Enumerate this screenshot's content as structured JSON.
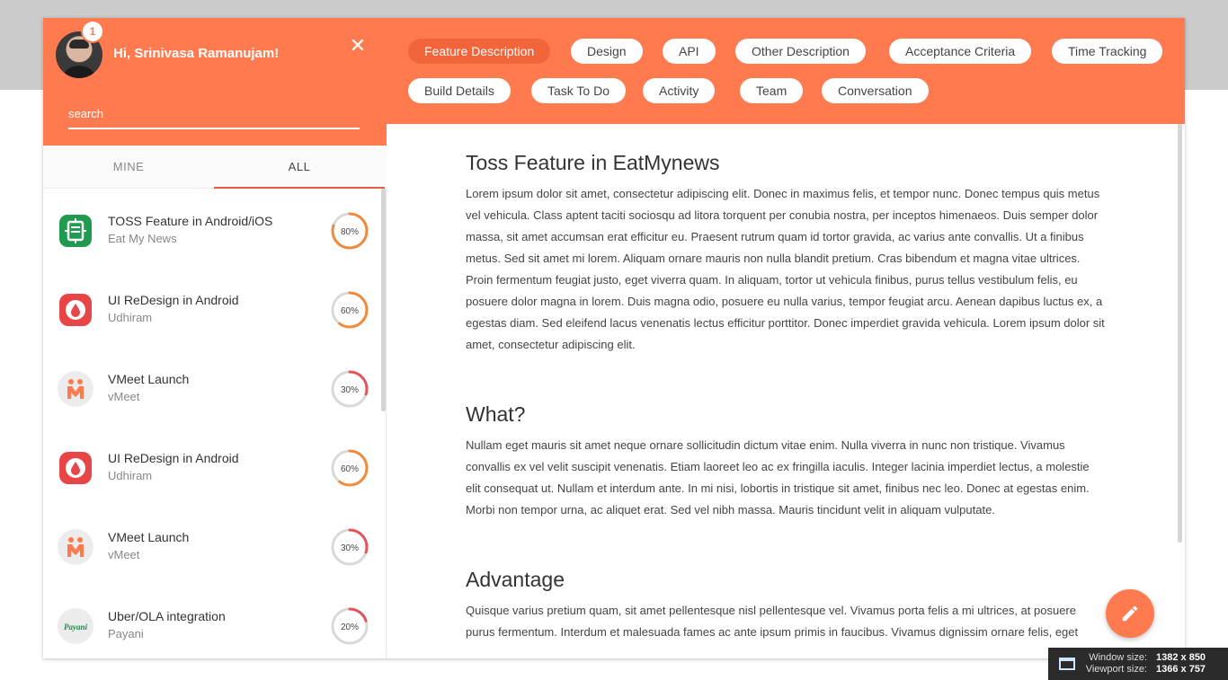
{
  "user": {
    "greeting": "Hi, Srinivasa Ramanujam!",
    "notification_count": "1"
  },
  "search": {
    "placeholder": "search"
  },
  "tabs": [
    {
      "label": "MINE"
    },
    {
      "label": "ALL",
      "active": true
    }
  ],
  "items": [
    {
      "title": "TOSS Feature in Android/iOS",
      "subtitle": "Eat My News",
      "progress": 80,
      "progress_label": "80%",
      "logo": "eatmynews-logo"
    },
    {
      "title": "UI ReDesign in Android",
      "subtitle": "Udhiram",
      "progress": 60,
      "progress_label": "60%",
      "logo": "udhiram-logo"
    },
    {
      "title": "VMeet Launch",
      "subtitle": "vMeet",
      "progress": 30,
      "progress_label": "30%",
      "logo": "vmeet-logo"
    },
    {
      "title": "UI ReDesign in Android",
      "subtitle": "Udhiram",
      "progress": 60,
      "progress_label": "60%",
      "logo": "udhiram-logo"
    },
    {
      "title": "VMeet Launch",
      "subtitle": "vMeet",
      "progress": 30,
      "progress_label": "30%",
      "logo": "vmeet-logo"
    },
    {
      "title": "Uber/OLA integration",
      "subtitle": "Payani",
      "progress": 20,
      "progress_label": "20%",
      "logo": "payani-logo",
      "logo_text": "Payani"
    }
  ],
  "nav_pills": [
    {
      "label": "Feature Description",
      "active": true
    },
    {
      "label": "Design"
    },
    {
      "label": "API"
    },
    {
      "label": "Other Description"
    },
    {
      "label": "Acceptance Criteria"
    },
    {
      "label": "Time Tracking"
    },
    {
      "label": "Build Details"
    },
    {
      "label": "Task To Do"
    },
    {
      "label": "Activity"
    },
    {
      "label": "Team"
    },
    {
      "label": "Conversation"
    }
  ],
  "sections": [
    {
      "title": "Toss Feature in EatMynews",
      "body": "Lorem ipsum dolor sit amet, consectetur adipiscing elit. Donec in maximus felis, et tempor nunc. Donec tempus quis metus vel vehicula. Class aptent taciti sociosqu ad litora torquent per conubia nostra, per inceptos himenaeos. Duis semper dolor massa, sit amet accumsan erat efficitur eu. Praesent rutrum quam id tortor gravida, ac varius ante convallis. Ut a finibus metus. Sed sit amet mi lorem. Aliquam ornare mauris non nulla blandit pretium. Cras bibendum et magna vitae ultrices. Proin fermentum feugiat justo, eget viverra quam. In aliquam, tortor ut vehicula finibus, purus tellus vestibulum felis, eu posuere dolor magna in lorem. Duis magna odio, posuere eu nulla varius, tempor feugiat arcu. Aenean dapibus luctus ex, a egestas diam. Sed eleifend lacus venenatis lectus efficitur porttitor. Donec imperdiet gravida vehicula. Lorem ipsum dolor sit amet, consectetur adipiscing elit."
    },
    {
      "title": "What?",
      "body": "Nullam eget mauris sit amet neque ornare sollicitudin dictum vitae enim. Nulla viverra in nunc non tristique. Vivamus convallis ex vel velit suscipit venenatis. Etiam laoreet leo ac ex fringilla iaculis. Integer lacinia imperdiet lectus, a molestie elit consequat ut. Nullam et interdum ante. In mi nisi, lobortis in tristique sit amet, finibus nec leo. Donec at egestas enim. Morbi non tempor urna, ac aliquet erat. Sed vel nibh massa. Mauris tincidunt velit in aliquam vulputate."
    },
    {
      "title": "Advantage",
      "body": "Quisque varius pretium quam, sit amet pellentesque nisl pellentesque vel. Vivamus porta felis a mi ultrices, at posuere purus fermentum. Interdum et malesuada fames ac ante ipsum primis in faucibus. Vivamus dignissim ornare felis, eget"
    }
  ],
  "fab": {
    "icon": "pencil-icon"
  },
  "window_info": {
    "window_label": "Window size:",
    "window_value": "1382 x 850",
    "viewport_label": "Viewport size:",
    "viewport_value": "1366 x 757"
  },
  "colors": {
    "accent": "#ff7b4f",
    "active_pill": "#f2643a",
    "progress_high": "#f08a3c",
    "progress_low": "#e2555a",
    "track": "#d9d9d9"
  }
}
